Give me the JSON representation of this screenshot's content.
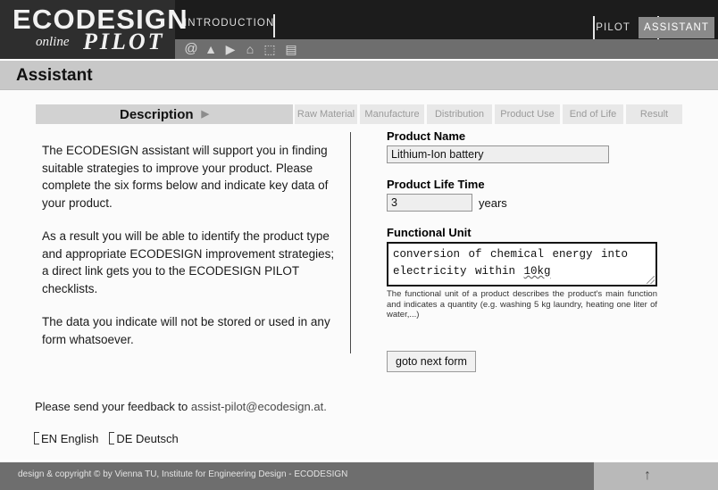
{
  "header": {
    "logo_main": "ECODESIGN",
    "logo_sub_italic": "online",
    "logo_sub_bold": "PILOT",
    "nav_intro": "INTRODUCTION",
    "nav_pilot": "PILOT",
    "nav_assistant": "ASSISTANT",
    "toolbar": {
      "at_icon": "@",
      "up_icon": "▲",
      "next_icon": "▶",
      "home_icon": "⌂",
      "page_icon": "⬚",
      "save_icon": "▤"
    }
  },
  "title": "Assistant",
  "tabs": [
    {
      "label": "Description",
      "active": true,
      "arrow": "▶"
    },
    {
      "label": "Raw Material",
      "active": false
    },
    {
      "label": "Manufacture",
      "active": false
    },
    {
      "label": "Distribution",
      "active": false
    },
    {
      "label": "Product Use",
      "active": false
    },
    {
      "label": "End of Life",
      "active": false
    },
    {
      "label": "Result",
      "active": false
    }
  ],
  "intro": {
    "p1": "The ECODESIGN assistant will support you in finding suitable strategies to improve your product. Please complete the six forms below and indicate key data of your product.",
    "p2": "As a result you will be able to identify the product type and appropriate ECODESIGN improvement strategies; a direct link gets you to the ECODESIGN PILOT checklists.",
    "p3": "The data you indicate will not be stored or used in any form whatsoever."
  },
  "form": {
    "product_name_label": "Product Name",
    "product_name_value": "Lithium-Ion battery",
    "product_name_placeholder": "",
    "life_time_label": "Product Life Time",
    "life_time_value": "3",
    "life_time_unit": "years",
    "functional_unit_label": "Functional Unit",
    "functional_unit_text_before": "conversion of chemical energy into electricity within ",
    "functional_unit_text_flagged": "10kg",
    "functional_unit_help": "The functional unit of a product describes the product's main function and indicates a quantity (e.g. washing 5 kg laundry, heating one liter of water,...)",
    "next_button": "goto next form"
  },
  "feedback": {
    "prefix": "Please send your feedback to ",
    "email": "assist-pilot@ecodesign.at."
  },
  "languages": [
    {
      "code": "EN",
      "label": "English"
    },
    {
      "code": "DE",
      "label": "Deutsch"
    }
  ],
  "footer": {
    "copyright": "design & copyright © by Vienna TU, Institute for Engineering Design - ECODESIGN",
    "top_arrow": "↑"
  }
}
